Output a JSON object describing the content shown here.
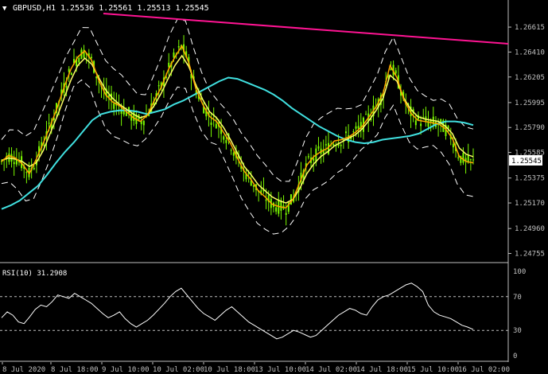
{
  "header": {
    "arrow": "▼",
    "symbol_tf": "GBPUSD,H1",
    "ohlc": "1.25536 1.25561 1.25513 1.25545"
  },
  "rsi_header": "RSI(10) 31.2908",
  "colors": {
    "background": "#000000",
    "candle": "#7CFC00",
    "ma_fast": "#FFA500",
    "ma_mid": "#FFFF66",
    "ma_slow": "#40E0E0",
    "bands": "#FFFFFF",
    "trendline": "#FF1493",
    "axis": "#C0C0C0"
  },
  "chart_data": [
    {
      "type": "line",
      "title": "GBPUSD,H1",
      "price_axis_labels": [
        "1.26615",
        "1.26410",
        "1.26205",
        "1.25995",
        "1.25790",
        "1.25585",
        "1.25375",
        "1.25170",
        "1.24960",
        "1.24755"
      ],
      "current_price_label": "1.25545",
      "ylim": [
        1.2468,
        1.2672
      ],
      "x_time_labels": [
        "8 Jul 2020",
        "8 Jul 18:00",
        "9 Jul 10:00",
        "10 Jul 02:00",
        "10 Jul 18:00",
        "13 Jul 10:00",
        "14 Jul 02:00",
        "14 Jul 18:00",
        "15 Jul 10:00",
        "16 Jul 02:00"
      ],
      "bars": 190,
      "series": [
        {
          "values": [
            1.2551,
            1.2556,
            1.2554,
            1.2549,
            1.2541,
            1.2553,
            1.2566,
            1.258,
            1.2595,
            1.2612,
            1.2627,
            1.2637,
            1.2642,
            1.2634,
            1.2618,
            1.2606,
            1.26,
            1.2597,
            1.2592,
            1.2587,
            1.2584,
            1.2589,
            1.2601,
            1.2612,
            1.2626,
            1.2637,
            1.2646,
            1.2632,
            1.2611,
            1.2598,
            1.2588,
            1.2584,
            1.2575,
            1.2566,
            1.2554,
            1.2543,
            1.2536,
            1.2527,
            1.2522,
            1.2516,
            1.2514,
            1.2513,
            1.252,
            1.2534,
            1.2548,
            1.2555,
            1.2559,
            1.2562,
            1.2568,
            1.2569,
            1.2571,
            1.2575,
            1.258,
            1.2588,
            1.2596,
            1.2607,
            1.263,
            1.262,
            1.2602,
            1.2591,
            1.2585,
            1.2584,
            1.2583,
            1.2582,
            1.2578,
            1.257,
            1.2555,
            1.2551,
            1.255
          ]
        },
        {
          "name": "",
          "values": [
            1.2552,
            1.2554,
            1.2553,
            1.2551,
            1.2547,
            1.255,
            1.256,
            1.2574,
            1.2588,
            1.2603,
            1.2618,
            1.263,
            1.2636,
            1.2631,
            1.262,
            1.261,
            1.2603,
            1.2598,
            1.2594,
            1.259,
            1.2587,
            1.2589,
            1.2597,
            1.2607,
            1.2619,
            1.263,
            1.2638,
            1.2629,
            1.2614,
            1.2602,
            1.2592,
            1.2587,
            1.2579,
            1.2569,
            1.2558,
            1.2547,
            1.254,
            1.2532,
            1.2527,
            1.2522,
            1.2519,
            1.2517,
            1.252,
            1.2529,
            1.2541,
            1.2549,
            1.2555,
            1.2559,
            1.2564,
            1.2567,
            1.257,
            1.2573,
            1.2578,
            1.2585,
            1.2593,
            1.2603,
            1.2622,
            1.2617,
            1.2603,
            1.2594,
            1.2588,
            1.2586,
            1.2585,
            1.2584,
            1.258,
            1.2574,
            1.2562,
            1.2557,
            1.2555
          ]
        },
        {
          "name": "",
          "values": [
            1.2512,
            1.2515,
            1.2519,
            1.2525,
            1.2531,
            1.254,
            1.255,
            1.2559,
            1.2567,
            1.2576,
            1.2585,
            1.259,
            1.2592,
            1.2593,
            1.2593,
            1.2592,
            1.259,
            1.2592,
            1.2594,
            1.2598,
            1.2601,
            1.2605,
            1.2609,
            1.2613,
            1.2617,
            1.262,
            1.2619,
            1.2616,
            1.2613,
            1.261,
            1.2606,
            1.2601,
            1.2595,
            1.259,
            1.2585,
            1.258,
            1.2576,
            1.2572,
            1.2569,
            1.2567,
            1.2566,
            1.2567,
            1.2569,
            1.257,
            1.2571,
            1.2572,
            1.2574,
            1.2578,
            1.2582,
            1.2584,
            1.2584,
            1.2583,
            1.2581
          ]
        }
      ]
    },
    {
      "type": "line",
      "title": "RSI(10) 31.2908",
      "y_labels": [
        "100",
        "70",
        "30",
        "0"
      ],
      "levels": [
        70,
        30
      ],
      "ylim": [
        0,
        100
      ],
      "series": [
        {
          "name": "RSI(10)",
          "values": [
            45,
            52,
            48,
            40,
            38,
            46,
            55,
            60,
            58,
            64,
            72,
            70,
            68,
            74,
            70,
            66,
            62,
            56,
            50,
            45,
            48,
            52,
            44,
            38,
            34,
            38,
            42,
            48,
            55,
            62,
            70,
            76,
            80,
            72,
            64,
            56,
            50,
            46,
            42,
            48,
            54,
            58,
            52,
            46,
            40,
            36,
            32,
            28,
            24,
            20,
            22,
            26,
            30,
            28,
            25,
            22,
            24,
            30,
            36,
            42,
            48,
            52,
            56,
            54,
            50,
            48,
            58,
            66,
            70,
            72,
            76,
            80,
            84,
            86,
            82,
            76,
            60,
            52,
            48,
            46,
            44,
            40,
            36,
            34,
            31
          ]
        }
      ]
    }
  ]
}
